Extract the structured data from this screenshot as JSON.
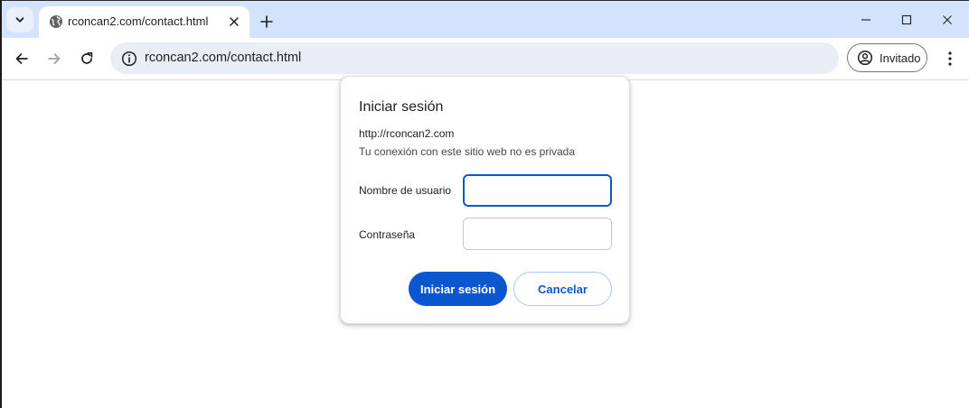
{
  "browser": {
    "tab": {
      "title": "rconcan2.com/contact.html",
      "favicon": "globe-icon"
    },
    "address_bar": {
      "url": "rconcan2.com/contact.html",
      "site_info_icon": "info-icon"
    },
    "profile": {
      "label": "Invitado",
      "icon": "account-circle-icon"
    }
  },
  "dialog": {
    "title": "Iniciar sesión",
    "origin": "http://rconcan2.com",
    "privacy_note": "Tu conexión con este sitio web no es privada",
    "username_label": "Nombre de usuario",
    "username_value": "",
    "password_label": "Contraseña",
    "password_value": "",
    "submit_label": "Iniciar sesión",
    "cancel_label": "Cancelar"
  },
  "colors": {
    "tabstrip": "#d3e3fd",
    "omnibox": "#e9eef6",
    "accent": "#0b57d0"
  }
}
